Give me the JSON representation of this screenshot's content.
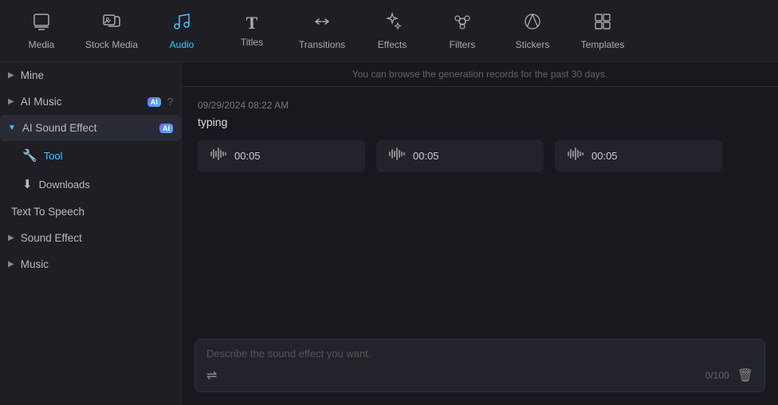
{
  "topnav": {
    "items": [
      {
        "id": "media",
        "label": "Media",
        "icon": "⬜",
        "iconType": "media",
        "active": false
      },
      {
        "id": "stock-media",
        "label": "Stock Media",
        "icon": "📷",
        "iconType": "stock",
        "active": false
      },
      {
        "id": "audio",
        "label": "Audio",
        "icon": "♪",
        "iconType": "audio",
        "active": true
      },
      {
        "id": "titles",
        "label": "Titles",
        "icon": "T",
        "iconType": "titles",
        "active": false
      },
      {
        "id": "transitions",
        "label": "Transitions",
        "icon": "⇄",
        "iconType": "transitions",
        "active": false
      },
      {
        "id": "effects",
        "label": "Effects",
        "icon": "✦",
        "iconType": "effects",
        "active": false
      },
      {
        "id": "filters",
        "label": "Filters",
        "icon": "⚙",
        "iconType": "filters",
        "active": false
      },
      {
        "id": "stickers",
        "label": "Stickers",
        "icon": "🌀",
        "iconType": "stickers",
        "active": false
      },
      {
        "id": "templates",
        "label": "Templates",
        "icon": "▦",
        "iconType": "templates",
        "active": false
      }
    ]
  },
  "sidebar": {
    "mine_label": "Mine",
    "ai_music_label": "AI Music",
    "ai_sound_effect_label": "AI Sound Effect",
    "tool_label": "Tool",
    "downloads_label": "Downloads",
    "text_to_speech_label": "Text To Speech",
    "sound_effect_label": "Sound Effect",
    "music_label": "Music"
  },
  "main": {
    "info_text": "You can browse the generation records for the past 30 days.",
    "timestamp": "09/29/2024 08:22 AM",
    "keyword": "typing",
    "audio_cards": [
      {
        "duration": "00:05"
      },
      {
        "duration": "00:05"
      },
      {
        "duration": "00:05"
      }
    ],
    "input_placeholder": "Describe the sound effect you want.",
    "char_count": "0/100"
  }
}
